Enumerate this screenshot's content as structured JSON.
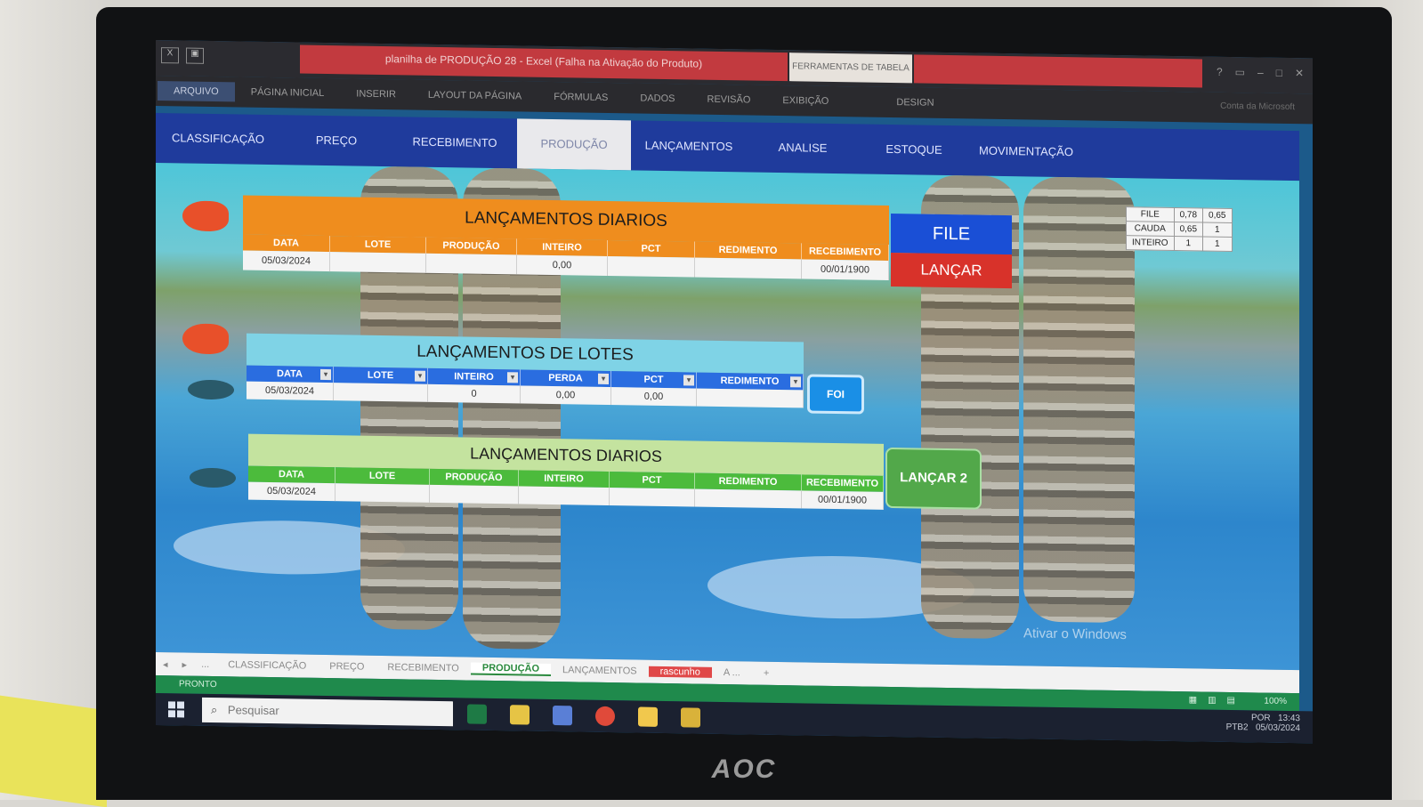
{
  "window": {
    "title": "planilha de PRODUÇÃO 28 - Excel (Falha na Ativação do Produto)",
    "context_group": "FERRAMENTAS DE TABELA",
    "account": "Conta da Microsoft"
  },
  "ribbon_tabs": [
    "ARQUIVO",
    "PÁGINA INICIAL",
    "INSERIR",
    "LAYOUT DA PÁGINA",
    "FÓRMULAS",
    "DADOS",
    "REVISÃO",
    "EXIBIÇÃO",
    "DESIGN"
  ],
  "nav": {
    "items": [
      "CLASSIFICAÇÃO",
      "PREÇO",
      "RECEBIMENTO",
      "PRODUÇÃO",
      "LANÇAMENTOS",
      "ANALISE",
      "ESTOQUE",
      "MOVIMENTAÇÃO"
    ],
    "active": "PRODUÇÃO"
  },
  "section1": {
    "title": "LANÇAMENTOS DIARIOS",
    "columns": [
      "DATA",
      "LOTE",
      "PRODUÇÃO",
      "INTEIRO",
      "PCT",
      "REDIMENTO",
      "RECEBIMENTO"
    ],
    "row": [
      "05/03/2024",
      "",
      "",
      "0,00",
      "",
      "",
      "00/01/1900"
    ],
    "file_button": "FILE",
    "lancar_button": "LANÇAR"
  },
  "mini_table": {
    "rows": [
      [
        "FILE",
        "0,78",
        "0,65"
      ],
      [
        "CAUDA",
        "0,65",
        "1"
      ],
      [
        "INTEIRO",
        "1",
        "1"
      ]
    ]
  },
  "section2": {
    "title": "LANÇAMENTOS DE LOTES",
    "columns": [
      "DATA",
      "LOTE",
      "INTEIRO",
      "PERDA",
      "PCT",
      "REDIMENTO"
    ],
    "row": [
      "05/03/2024",
      "",
      "0",
      "0,00",
      "0,00",
      ""
    ],
    "button": "FOI"
  },
  "section3": {
    "title": "LANÇAMENTOS DIARIOS",
    "columns": [
      "DATA",
      "LOTE",
      "PRODUÇÃO",
      "INTEIRO",
      "PCT",
      "REDIMENTO",
      "RECEBIMENTO"
    ],
    "row": [
      "05/03/2024",
      "",
      "",
      "",
      "",
      "",
      "00/01/1900"
    ],
    "button": "LANÇAR 2"
  },
  "watermark": "Ativar o Windows",
  "sheet_tabs": {
    "ellipsis": "...",
    "tabs": [
      "CLASSIFICAÇÃO",
      "PREÇO",
      "RECEBIMENTO",
      "PRODUÇÃO",
      "LANÇAMENTOS",
      "rascunho",
      "A ..."
    ],
    "active": "PRODUÇÃO",
    "add": "+"
  },
  "status": {
    "text": "PRONTO",
    "zoom": "100%"
  },
  "taskbar": {
    "search_placeholder": "Pesquisar",
    "lang": "POR",
    "layout": "PTB2",
    "time": "13:43",
    "date": "05/03/2024"
  },
  "monitor": {
    "brand": "AOC"
  },
  "colors": {
    "nav": "#1f3b9c",
    "orange_header": "#ef8d1e",
    "blue_columns": "#2a6de0",
    "cyan_header": "#7fd3e6",
    "green_header": "#c4e39f",
    "green_columns": "#4cbb3c",
    "red_button": "#d8322a",
    "blue_button": "#1a4fd6",
    "green_button": "#52a84a",
    "status": "#1f8a4c"
  }
}
